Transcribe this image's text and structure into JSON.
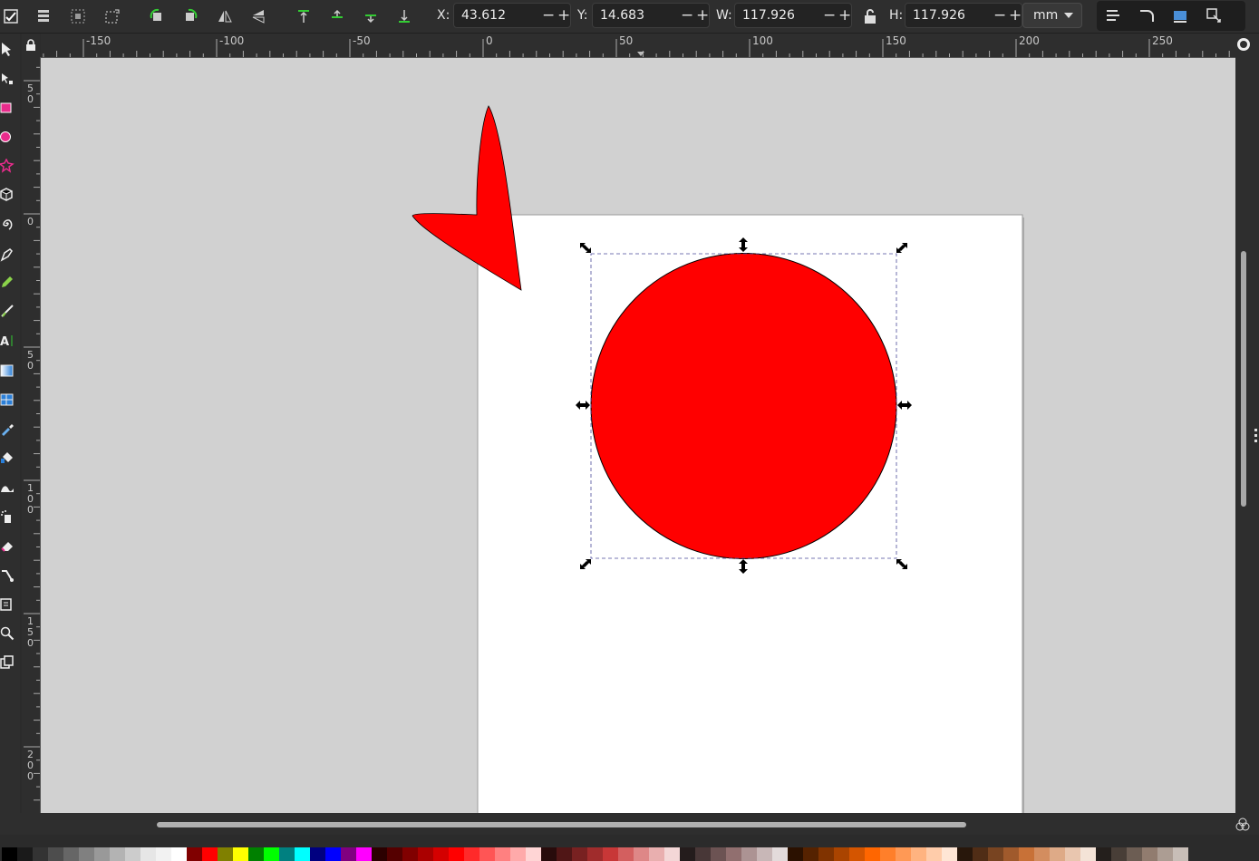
{
  "toolbar": {
    "x_label": "X:",
    "x_value": "43.612",
    "y_label": "Y:",
    "y_value": "14.683",
    "w_label": "W:",
    "w_value": "117.926",
    "h_label": "H:",
    "h_value": "117.926",
    "unit": "mm",
    "minus": "−",
    "plus": "+"
  },
  "ruler": {
    "h_labels": [
      "-150",
      "-100",
      "-50",
      "0",
      "50",
      "100",
      "150",
      "200",
      "250"
    ],
    "v_labels": [
      "5\n0",
      "0",
      "5\n0",
      "1\n0\n0",
      "1\n5\n0",
      "2\n0\n0"
    ]
  },
  "canvas": {
    "page_color": "#ffffff",
    "desk_color": "#d1d1d1",
    "shape_fill": "#ff0000",
    "shape_stroke": "#000000",
    "selection_color": "#5a5aa0"
  },
  "tools": [
    "selector-tool",
    "node-tool",
    "rectangle-tool",
    "ellipse-tool",
    "star-tool",
    "3d-box-tool",
    "spiral-tool",
    "pen-tool",
    "pencil-tool",
    "calligraphy-tool",
    "text-tool",
    "gradient-tool",
    "mesh-tool",
    "dropper-tool",
    "paint-bucket-tool",
    "tweak-tool",
    "spray-tool",
    "eraser-tool",
    "connector-tool",
    "pages-tool",
    "zoom-tool",
    "measure-tool"
  ],
  "palette": [
    "#000000",
    "#1a1a1a",
    "#333333",
    "#4d4d4d",
    "#666666",
    "#808080",
    "#999999",
    "#b3b3b3",
    "#cccccc",
    "#e6e6e6",
    "#f2f2f2",
    "#ffffff",
    "#800000",
    "#ff0000",
    "#808000",
    "#ffff00",
    "#008000",
    "#00ff00",
    "#008080",
    "#00ffff",
    "#000080",
    "#0000ff",
    "#800080",
    "#ff00ff",
    "#2b0000",
    "#550000",
    "#800000",
    "#aa0000",
    "#d40000",
    "#ff0000",
    "#ff2a2a",
    "#ff5555",
    "#ff8080",
    "#ffaaaa",
    "#ffd5d5",
    "#280b0b",
    "#501616",
    "#782121",
    "#a02c2c",
    "#c83737",
    "#d35f5f",
    "#de8787",
    "#e9afaf",
    "#f4d7d7",
    "#241c1c",
    "#483737",
    "#6c5353",
    "#916f6f",
    "#ac9393",
    "#c8b7b7",
    "#e3dbdb",
    "#2b1100",
    "#552200",
    "#803300",
    "#aa4400",
    "#d45500",
    "#ff6600",
    "#ff7f2a",
    "#ff9955",
    "#ffb380",
    "#ffccaa",
    "#ffe6d5",
    "#28170b",
    "#502d16",
    "#784421",
    "#a05a2c",
    "#c87137",
    "#d38d5f",
    "#deaa87",
    "#e9c6af",
    "#f4e3d7",
    "#241f1c",
    "#483e37",
    "#6c5d53",
    "#917c6f",
    "#ac9d93",
    "#c8beb7"
  ]
}
